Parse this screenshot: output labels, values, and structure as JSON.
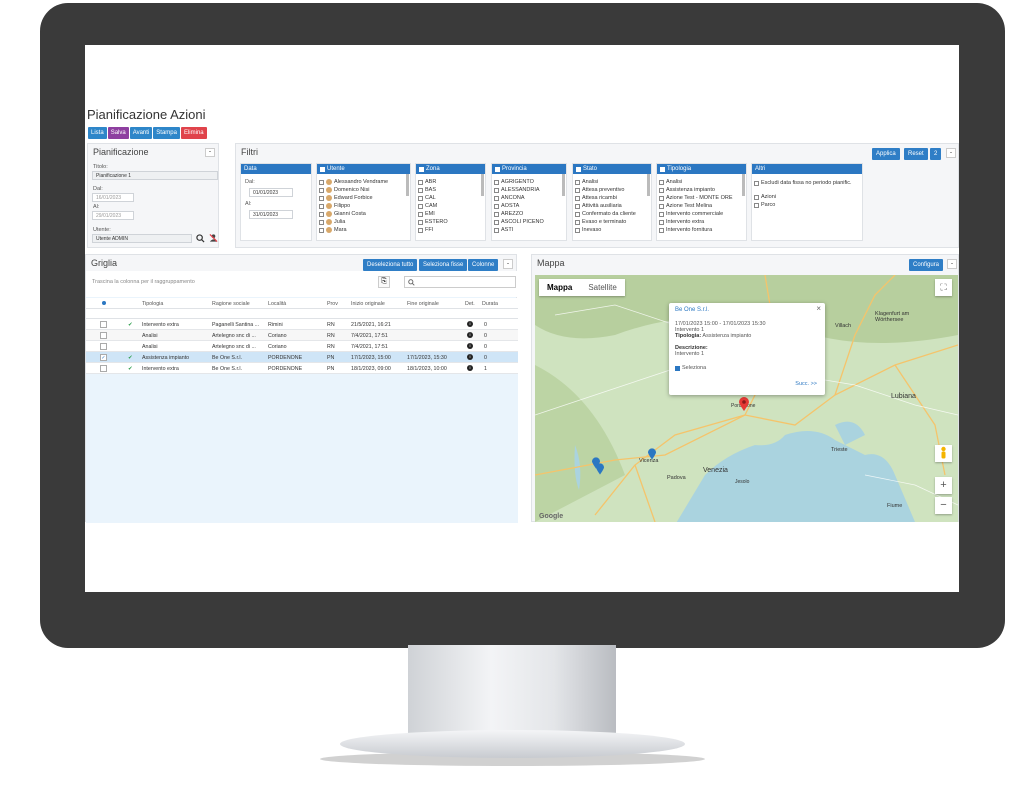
{
  "page": {
    "title": "Pianificazione Azioni"
  },
  "toolbar": [
    {
      "label": "Lista",
      "color": "#2e86c9"
    },
    {
      "label": "Salva",
      "color": "#8e3fa0"
    },
    {
      "label": "Avanti",
      "color": "#2e86c9"
    },
    {
      "label": "Stampa",
      "color": "#2e86c9"
    },
    {
      "label": "Elimina",
      "color": "#e0434b"
    }
  ],
  "pianificazione": {
    "header": "Pianificazione",
    "collapse": "-",
    "title_label": "Titolo:",
    "title_value": "Pianificazione 1",
    "dal_label": "Dal:",
    "dal_value": "16/01/2023",
    "al_label": "Al:",
    "al_value": "29/01/2023",
    "utente_label": "Utente:",
    "utente_value": "Utente ADMIN"
  },
  "filtri": {
    "header": "Filtri",
    "applica": "Applica",
    "reset": "Reset",
    "count": "2",
    "collapse": "-",
    "data": {
      "header": "Data",
      "dal_label": "Dal:",
      "dal_value": "01/01/2023",
      "al_label": "Al:",
      "al_value": "31/01/2023"
    },
    "utente": {
      "header": "Utente",
      "items": [
        "Alessandro Vendrame",
        "Domenico Nisi",
        "Edward Forbice",
        "Filippo",
        "Gianni Costa",
        "Julia",
        "Mara"
      ]
    },
    "zona": {
      "header": "Zona",
      "items": [
        "ABR",
        "BAS",
        "CAL",
        "CAM",
        "EMI",
        "ESTERO",
        "FFI"
      ]
    },
    "provincia": {
      "header": "Provincia",
      "items": [
        "AGRIGENTO",
        "ALESSANDRIA",
        "ANCONA",
        "AOSTA",
        "AREZZO",
        "ASCOLI PICENO",
        "ASTI"
      ]
    },
    "stato": {
      "header": "Stato",
      "items": [
        "Analisi",
        "Attesa preventivo",
        "Attesa ricambi",
        "Attività ausiliaria",
        "Confermato da cliente",
        "Evaso e terminato",
        "Inevaso"
      ]
    },
    "tipologia": {
      "header": "Tipologia",
      "items": [
        "Analisi",
        "Assistenza impianto",
        "Azione Test - MONTE ORE",
        "Azione Test Melina",
        "Intervento commerciale",
        "Intervento extra",
        "Intervento fornitura"
      ]
    },
    "altri": {
      "header": "Altri",
      "items": [
        "Escludi data fissa no periodo pianific.",
        "Azioni",
        "Parco"
      ]
    }
  },
  "griglia": {
    "header": "Griglia",
    "btn_deselect": "Deseleziona tutto",
    "btn_select": "Seleziona fisse",
    "btn_cols": "Colonne",
    "collapse": "-",
    "group_hint": "Trascina la colonna per il raggruppamento",
    "columns": [
      "Tipologia",
      "Ragione sociale",
      "Località",
      "Prov",
      "Inizio originale",
      "Fine originale",
      "Det.",
      "Durata"
    ],
    "rows": [
      {
        "done": "✔",
        "sel": "",
        "tip": "Intervento extra",
        "rag": "Paganelli Santina ...",
        "loc": "Rimini",
        "prov": "RN",
        "ini": "21/5/2021, 16:21",
        "fine": "",
        "dur": "0"
      },
      {
        "done": "",
        "sel": "",
        "tip": "Analisi",
        "rag": "Artelegno snc di ...",
        "loc": "Coriano",
        "prov": "RN",
        "ini": "7/4/2021, 17:51",
        "fine": "",
        "dur": "0"
      },
      {
        "done": "",
        "sel": "",
        "tip": "Analisi",
        "rag": "Artelegno snc di ...",
        "loc": "Coriano",
        "prov": "RN",
        "ini": "7/4/2021, 17:51",
        "fine": "",
        "dur": "0"
      },
      {
        "done": "✔",
        "sel": "✓",
        "tip": "Assistenza impianto",
        "rag": "Be One S.r.l.",
        "loc": "PORDENONE",
        "prov": "PN",
        "ini": "17/1/2023, 15:00",
        "fine": "17/1/2023, 15:30",
        "dur": "0"
      },
      {
        "done": "✔",
        "sel": "",
        "tip": "Intervento extra",
        "rag": "Be One S.r.l.",
        "loc": "PORDENONE",
        "prov": "PN",
        "ini": "18/1/2023, 09:00",
        "fine": "18/1/2023, 10:00",
        "dur": "1"
      }
    ]
  },
  "mappa": {
    "header": "Mappa",
    "configura": "Configura",
    "collapse": "-",
    "tab_map": "Mappa",
    "tab_sat": "Satellite",
    "popup": {
      "title": "Be One S.r.l.",
      "line1": "17/01/2023 15:00 - 17/01/2023 15:30",
      "line2": "Intervento 1",
      "tip_label": "Tipologia:",
      "tip_value": "Assistenza impianto",
      "desc_label": "Descrizione:",
      "desc_value": "Intervento 1",
      "sel_label": "Seleziona",
      "next": "Succ. >>"
    },
    "places": [
      "Villach",
      "Klagenfurt am Wörthersee",
      "Lubiana",
      "Vicenza",
      "Venezia",
      "Padova",
      "Trieste",
      "Pordenone",
      "Jesolo",
      "Fiume"
    ],
    "zoom_in": "+",
    "zoom_out": "−"
  }
}
